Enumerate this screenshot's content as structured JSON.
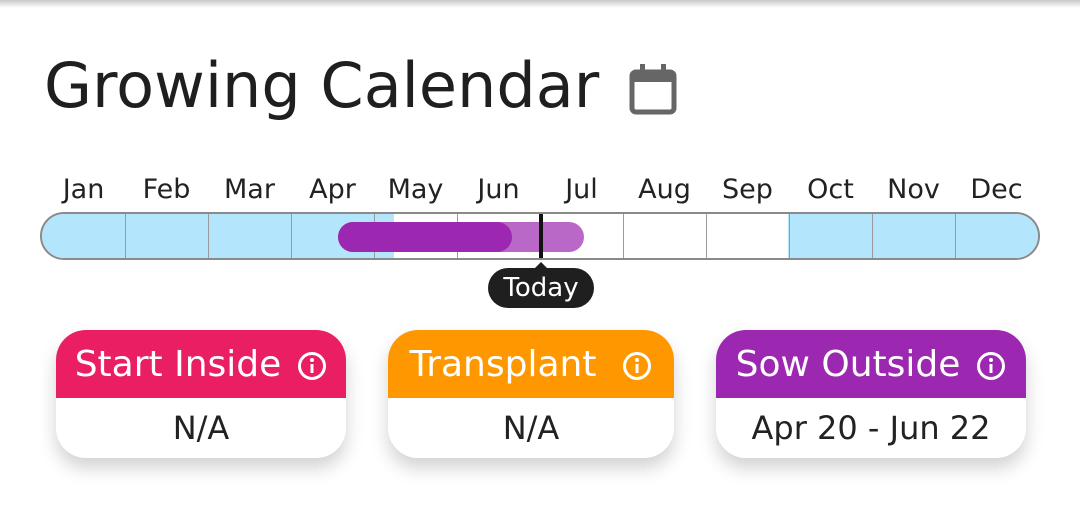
{
  "header": {
    "title": "Growing Calendar",
    "icon": "calendar-icon"
  },
  "months": [
    "Jan",
    "Feb",
    "Mar",
    "Apr",
    "May",
    "Jun",
    "Jul",
    "Aug",
    "Sep",
    "Oct",
    "Nov",
    "Dec"
  ],
  "timeline": {
    "today_label": "Today",
    "colors": {
      "off_season": "#b3e5fc",
      "in_season": "#ffffff",
      "sow_window": "#9c27b0",
      "sow_window_light": "#ba68c8",
      "today": "#111111"
    }
  },
  "cards": [
    {
      "title": "Start Inside",
      "value": "N/A",
      "color": "#e91e63",
      "icon": "info-icon"
    },
    {
      "title": "Transplant",
      "value": "N/A",
      "color": "#ff9800",
      "icon": "info-icon"
    },
    {
      "title": "Sow Outside",
      "value": "Apr 20 - Jun 22",
      "color": "#9c27b0",
      "icon": "info-icon"
    }
  ]
}
